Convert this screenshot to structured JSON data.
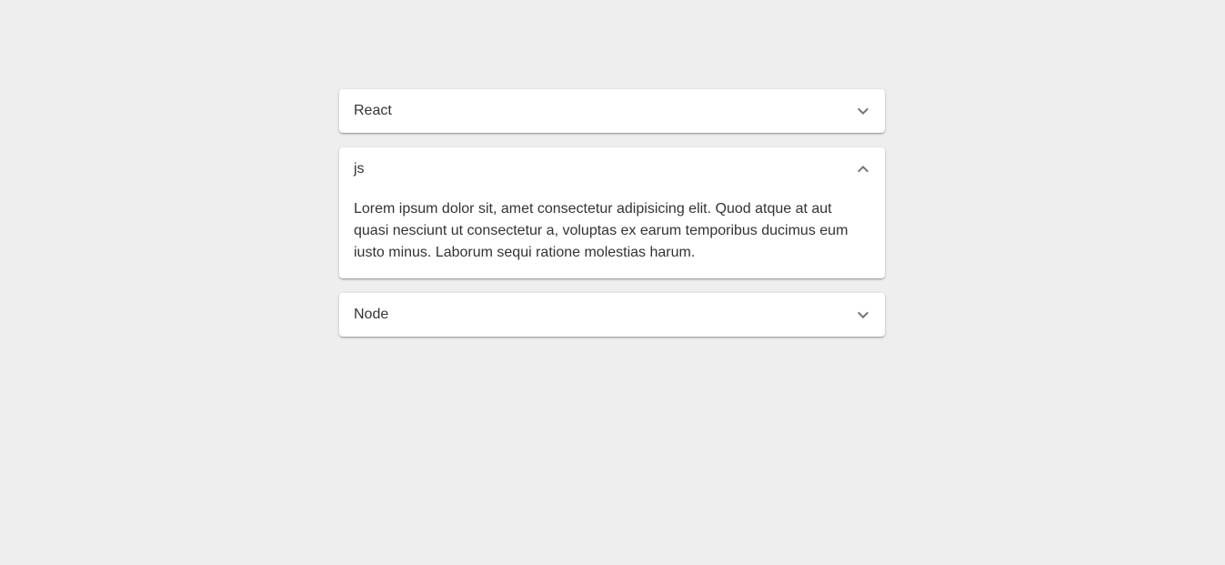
{
  "accordion": {
    "panels": [
      {
        "title": "React",
        "expanded": false,
        "icon": "chevron-down-icon"
      },
      {
        "title": "js",
        "expanded": true,
        "icon": "chevron-up-icon",
        "body": "Lorem ipsum dolor sit, amet consectetur adipisicing elit. Quod atque at aut quasi nesciunt ut consectetur a, voluptas ex earum temporibus ducimus eum iusto minus. Laborum sequi ratione molestias harum."
      },
      {
        "title": "Node",
        "expanded": false,
        "icon": "chevron-down-icon"
      }
    ]
  },
  "colors": {
    "page_background": "#eeeeee",
    "panel_background": "#ffffff",
    "text": "#333333",
    "icon": "#757575"
  }
}
